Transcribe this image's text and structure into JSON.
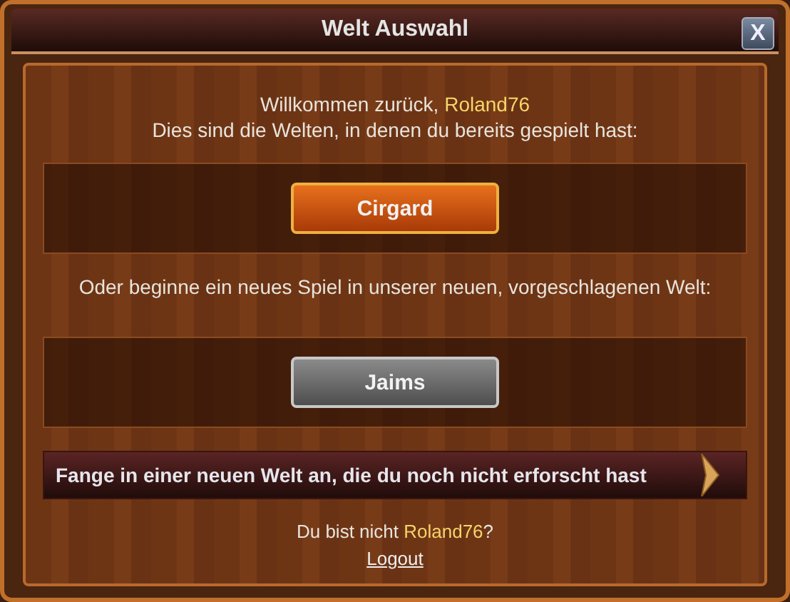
{
  "window": {
    "title": "Welt Auswahl",
    "close": "X"
  },
  "welcome": {
    "greeting": "Willkommen zurück, ",
    "name": "Roland76",
    "subtitle": "Dies sind die Welten, in denen du bereits gespielt hast:"
  },
  "played_worlds": [
    {
      "label": "Cirgard",
      "kind": "played"
    }
  ],
  "suggest_text": "Oder beginne ein neues Spiel in unserer neuen, vorgeschlagenen Welt:",
  "suggested_worlds": [
    {
      "label": "Jaims",
      "kind": "suggested"
    }
  ],
  "new_world_button": "Fange in einer neuen Welt an, die du noch nicht erforscht hast",
  "not_you": {
    "prefix": "Du bist nicht ",
    "name": "Roland76",
    "suffix": "?"
  },
  "logout": "Logout"
}
